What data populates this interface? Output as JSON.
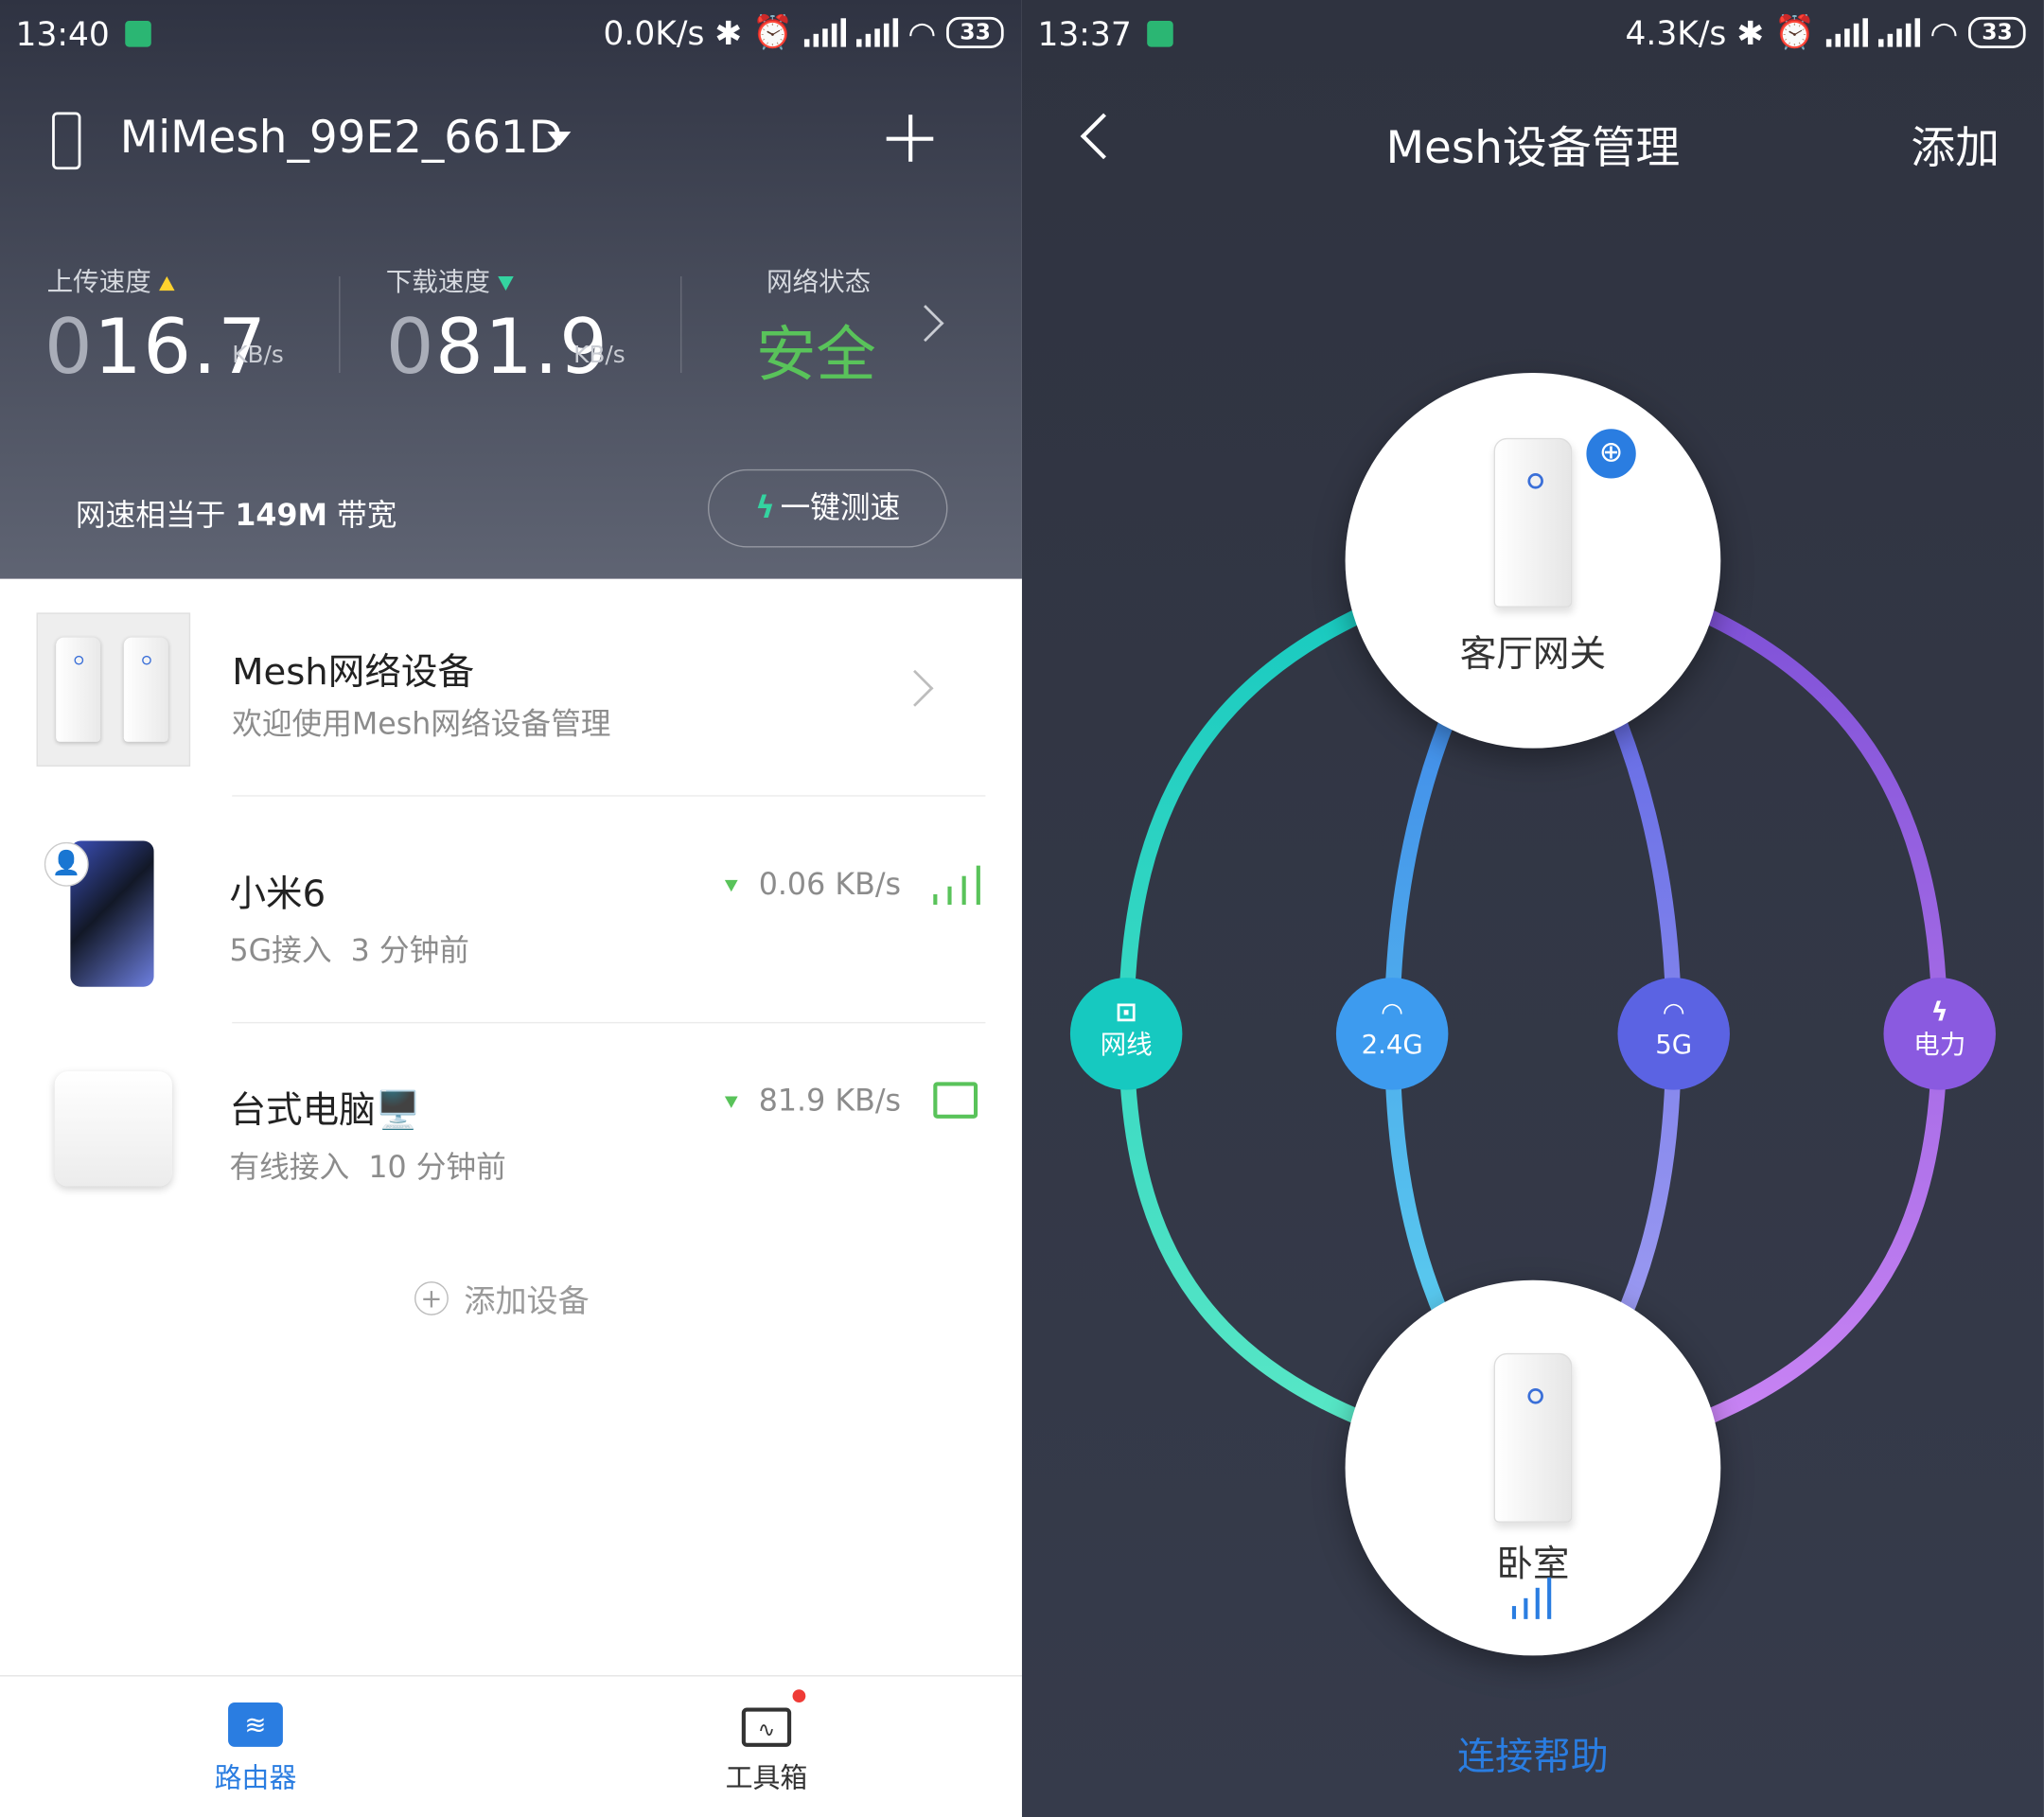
{
  "left_phone": {
    "status_bar": {
      "time": "13:40",
      "net_speed": "0.0K/s",
      "battery": "33"
    },
    "header": {
      "network_name": "MiMesh_99E2_661D",
      "add_icon": "plus-icon"
    },
    "stats": {
      "upload_label": "上传速度",
      "upload_lead": "0",
      "upload_value": "16.7",
      "upload_unit": "KB/s",
      "download_label": "下载速度",
      "download_lead": "0",
      "download_value": "81.9",
      "download_unit": "KB/s",
      "status_label": "网络状态",
      "status_value": "安全"
    },
    "bandwidth": {
      "prefix": "网速相当于",
      "value": "149M",
      "suffix": "带宽"
    },
    "speedtest_button": "一键测速",
    "mesh_card": {
      "title": "Mesh网络设备",
      "subtitle": "欢迎使用Mesh网络设备管理"
    },
    "devices": [
      {
        "name": "小米6",
        "connection": "5G接入",
        "time": "3 分钟前",
        "rate": "0.06 KB/s",
        "icon": "wifi-signal-icon"
      },
      {
        "name": "台式电脑",
        "name_icon": "🖥️",
        "connection": "有线接入",
        "time": "10 分钟前",
        "rate": "81.9 KB/s",
        "icon": "ethernet-icon"
      }
    ],
    "add_device": "添加设备",
    "nav": [
      {
        "label": "路由器",
        "active": true
      },
      {
        "label": "工具箱",
        "active": false
      }
    ],
    "colors": {
      "accent": "#2a7de1",
      "safe": "#59c35a",
      "upload": "#ffd22e",
      "download": "#34d3a0"
    }
  },
  "right_phone": {
    "status_bar": {
      "time": "13:37",
      "net_speed": "4.3K/s",
      "battery": "33"
    },
    "title": "Mesh设备管理",
    "add": "添加",
    "gateway_node": "客厅网关",
    "bedroom_node": "卧室",
    "links": [
      {
        "label": "网线",
        "icon": "ethernet-icon",
        "color": "#16c9c0"
      },
      {
        "label": "2.4G",
        "icon": "wifi-icon",
        "color": "#3d9bef"
      },
      {
        "label": "5G",
        "icon": "wifi-icon",
        "color": "#5b63e3"
      },
      {
        "label": "电力",
        "icon": "bolt-icon",
        "color": "#8a5ae0"
      }
    ],
    "help_link": "连接帮助"
  }
}
